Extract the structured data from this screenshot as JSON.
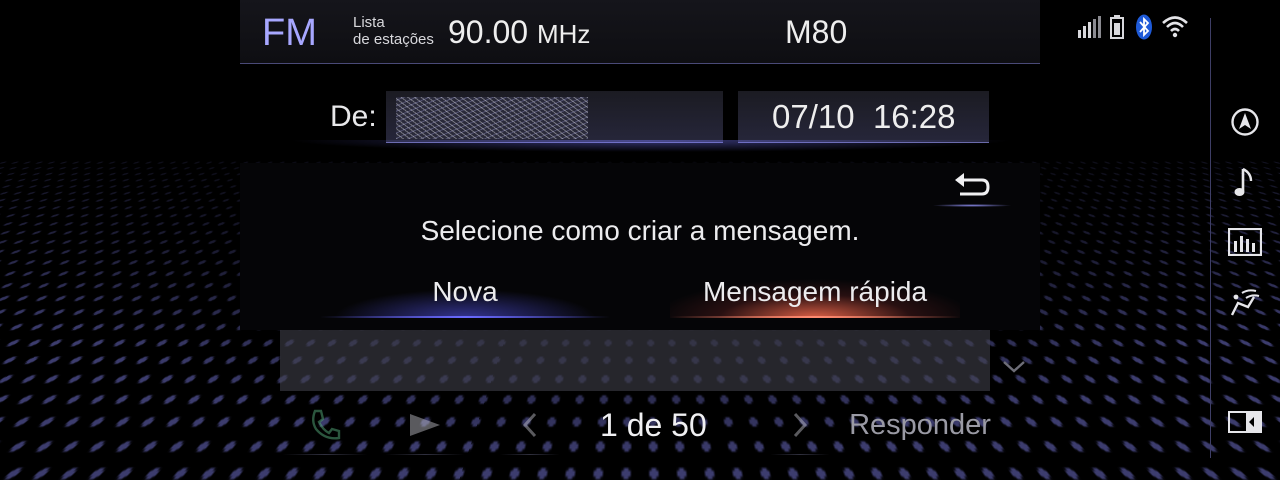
{
  "topbar": {
    "band": "FM",
    "station_list_line1": "Lista",
    "station_list_line2": "de estações",
    "frequency": "90.00",
    "frequency_unit": "MHz",
    "preset": "M80",
    "status_icons": [
      "signal-strength-icon",
      "phone-battery-icon",
      "bluetooth-icon",
      "wifi-icon"
    ]
  },
  "message": {
    "from_label": "De:",
    "date": "07/10",
    "time": "16:28"
  },
  "dialog": {
    "prompt": "Selecione como criar a mensagem.",
    "option_new": "Nova",
    "option_quick": "Mensagem rápida",
    "back_icon": "back-arrow-icon"
  },
  "bottom": {
    "page_counter": "1 de 50",
    "reply_label": "Responder",
    "icons": [
      "phone-icon",
      "play-icon",
      "prev-icon",
      "next-icon"
    ]
  },
  "rail": {
    "icons": [
      "navigation-icon",
      "music-note-icon",
      "equalizer-icon",
      "climate-seat-icon",
      "display-toggle-icon"
    ]
  },
  "colors": {
    "accent_blue": "#a7a7ff",
    "highlight_red": "#ff6e50"
  }
}
